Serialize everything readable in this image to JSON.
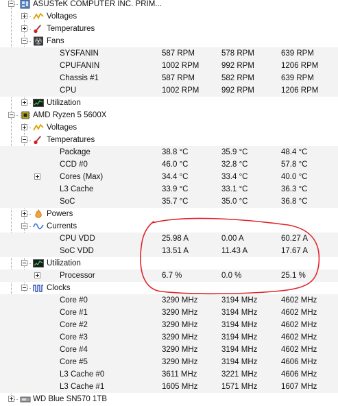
{
  "tree": {
    "nodes": [
      {
        "level": 0,
        "icon": "motherboard-icon",
        "label": "ASUSTeK COMPUTER INC. PRIM...",
        "expander": "minus"
      },
      {
        "level": 1,
        "icon": "voltage-icon",
        "label": "Voltages",
        "expander": "plus"
      },
      {
        "level": 1,
        "icon": "thermometer-icon",
        "label": "Temperatures",
        "expander": "plus"
      },
      {
        "level": 1,
        "icon": "fan-icon",
        "label": "Fans",
        "expander": "minus"
      },
      {
        "level": 2,
        "label": "SYSFANIN",
        "value": "587 RPM",
        "min": "578 RPM",
        "max": "639 RPM"
      },
      {
        "level": 2,
        "label": "CPUFANIN",
        "value": "1002 RPM",
        "min": "992 RPM",
        "max": "1206 RPM"
      },
      {
        "level": 2,
        "label": "Chassis #1",
        "value": "587 RPM",
        "min": "582 RPM",
        "max": "639 RPM"
      },
      {
        "level": 2,
        "label": "CPU",
        "value": "1002 RPM",
        "min": "992 RPM",
        "max": "1206 RPM"
      },
      {
        "level": 1,
        "icon": "utilization-icon",
        "label": "Utilization",
        "expander": "plus"
      },
      {
        "level": 0,
        "icon": "cpu-chip-icon",
        "label": "AMD Ryzen 5 5600X",
        "expander": "minus"
      },
      {
        "level": 1,
        "icon": "voltage-icon",
        "label": "Voltages",
        "expander": "plus"
      },
      {
        "level": 1,
        "icon": "thermometer-icon",
        "label": "Temperatures",
        "expander": "minus"
      },
      {
        "level": 2,
        "label": "Package",
        "value": "38.8 °C",
        "min": "35.9 °C",
        "max": "48.4 °C"
      },
      {
        "level": 2,
        "label": "CCD #0",
        "value": "46.0 °C",
        "min": "32.8 °C",
        "max": "57.8 °C"
      },
      {
        "level": 2,
        "label": "Cores (Max)",
        "value": "34.4 °C",
        "min": "33.4 °C",
        "max": "40.0 °C",
        "expander": "plus"
      },
      {
        "level": 2,
        "label": "L3 Cache",
        "value": "33.9 °C",
        "min": "33.1 °C",
        "max": "36.3 °C"
      },
      {
        "level": 2,
        "label": "SoC",
        "value": "35.7 °C",
        "min": "35.0 °C",
        "max": "36.8 °C"
      },
      {
        "level": 1,
        "icon": "power-icon",
        "label": "Powers",
        "expander": "plus"
      },
      {
        "level": 1,
        "icon": "current-icon",
        "label": "Currents",
        "expander": "minus"
      },
      {
        "level": 2,
        "label": "CPU VDD",
        "value": "25.98 A",
        "min": "0.00 A",
        "max": "60.27 A"
      },
      {
        "level": 2,
        "label": "SoC VDD",
        "value": "13.51 A",
        "min": "11.43 A",
        "max": "17.67 A"
      },
      {
        "level": 1,
        "icon": "utilization-icon",
        "label": "Utilization",
        "expander": "minus"
      },
      {
        "level": 2,
        "label": "Processor",
        "value": "6.7 %",
        "min": "0.0 %",
        "max": "25.1 %",
        "expander": "plus"
      },
      {
        "level": 1,
        "icon": "clock-icon",
        "label": "Clocks",
        "expander": "minus"
      },
      {
        "level": 2,
        "label": "Core #0",
        "value": "3290 MHz",
        "min": "3194 MHz",
        "max": "4602 MHz"
      },
      {
        "level": 2,
        "label": "Core #1",
        "value": "3290 MHz",
        "min": "3194 MHz",
        "max": "4602 MHz"
      },
      {
        "level": 2,
        "label": "Core #2",
        "value": "3290 MHz",
        "min": "3194 MHz",
        "max": "4602 MHz"
      },
      {
        "level": 2,
        "label": "Core #3",
        "value": "3290 MHz",
        "min": "3194 MHz",
        "max": "4602 MHz"
      },
      {
        "level": 2,
        "label": "Core #4",
        "value": "3290 MHz",
        "min": "3194 MHz",
        "max": "4602 MHz"
      },
      {
        "level": 2,
        "label": "Core #5",
        "value": "3290 MHz",
        "min": "3194 MHz",
        "max": "4606 MHz"
      },
      {
        "level": 2,
        "label": "L3 Cache #0",
        "value": "3611 MHz",
        "min": "3221 MHz",
        "max": "4606 MHz"
      },
      {
        "level": 2,
        "label": "L3 Cache #1",
        "value": "1605 MHz",
        "min": "1571 MHz",
        "max": "1607 MHz"
      },
      {
        "level": 0,
        "icon": "drive-icon",
        "label": "WD Blue SN570 1TB",
        "expander": "plus"
      }
    ]
  },
  "colors": {
    "annotation_stroke": "#e0242a",
    "row_shade": "#f3f3f3",
    "tree_line": "#a0a0a0"
  }
}
